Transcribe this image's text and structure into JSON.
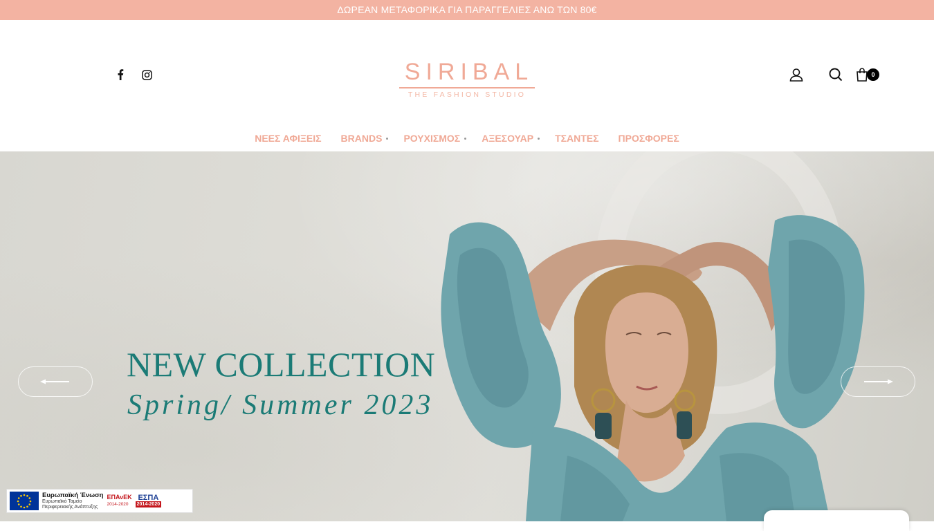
{
  "topbar": {
    "announcement": "ΔΩΡΕΑΝ ΜΕΤΑΦΟΡΙΚΑ ΓΙΑ ΠΑΡΑΓΓΕΛΙΕΣ ΑΝΩ ΤΩΝ 80€"
  },
  "header": {
    "logo_main": "SIRIBAL",
    "logo_sub": "THE FASHION STUDIO",
    "social": [
      {
        "icon": "facebook-icon"
      },
      {
        "icon": "instagram-icon"
      }
    ],
    "cart_count": "0"
  },
  "nav": {
    "items": [
      {
        "label": "ΝΕΕΣ ΑΦΙΞΕΙΣ",
        "has_submenu": false
      },
      {
        "label": "BRANDS",
        "has_submenu": true
      },
      {
        "label": "ΡΟΥΧΙΣΜΟΣ",
        "has_submenu": true
      },
      {
        "label": "ΑΞΕΣΟΥΑΡ",
        "has_submenu": true
      },
      {
        "label": "ΤΣΑΝΤΕΣ",
        "has_submenu": false
      },
      {
        "label": "ΠΡΟΣΦΟΡΕΣ",
        "has_submenu": false
      }
    ]
  },
  "hero": {
    "title": "NEW COLLECTION",
    "subtitle": "Spring/ Summer 2023",
    "prev_icon": "arrow-left-icon",
    "next_icon": "arrow-right-icon"
  },
  "espa_banner": {
    "eu_title": "Ευρωπαϊκή Ένωση",
    "eu_line1": "Ευρωπαϊκό Ταμείο",
    "eu_line2": "Περιφερειακής Ανάπτυξης",
    "epanek": "ΕΠΑνΕΚ",
    "epanek_years": "2014-2020",
    "espa": "ΕΣΠΑ",
    "espa_years": "2014-2020"
  },
  "colors": {
    "accent": "#f3b3a2",
    "nav_text": "#f0a996",
    "hero_text": "#1b7b76"
  }
}
